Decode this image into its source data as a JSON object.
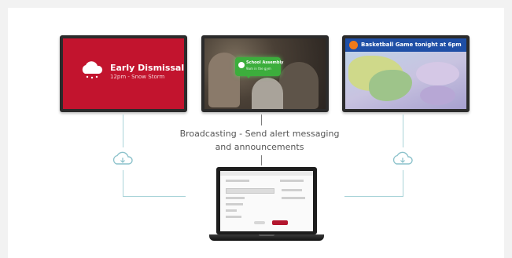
{
  "caption": {
    "line1": "Broadcasting - Send alert messaging",
    "line2": "and announcements"
  },
  "screens": {
    "left": {
      "title": "Early Dismissal",
      "subtitle": "12pm - Snow Storm",
      "icon": "snow-cloud-icon"
    },
    "middle": {
      "title": "School Assembly",
      "subtitle": "9am in the gym",
      "icon": "chat-bubble-icon"
    },
    "right": {
      "title": "Basketball Game tonight at 6pm",
      "icon": "basketball-icon"
    }
  },
  "icons": {
    "connectors": "cloud-icon",
    "device": "laptop-icon"
  },
  "colors": {
    "alert_red": "#c2142e",
    "assembly_green": "#3cae3c",
    "banner_blue": "#1f4fa6",
    "connector_teal": "#a9d3d8",
    "send_button": "#b3162e"
  }
}
